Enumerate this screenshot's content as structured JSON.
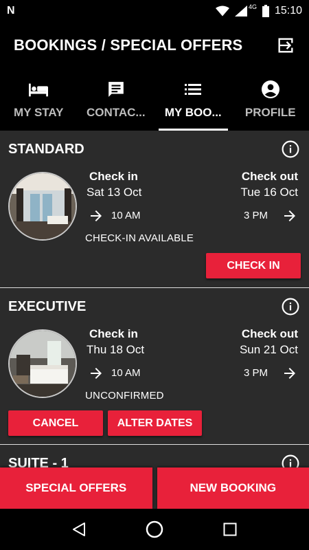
{
  "status_bar": {
    "time": "15:10",
    "network": "4G"
  },
  "app_bar": {
    "title": "BOOKINGS / SPECIAL OFFERS"
  },
  "tabs": [
    {
      "label": "MY STAY",
      "icon": "bed-icon"
    },
    {
      "label": "CONTAC...",
      "icon": "chat-icon"
    },
    {
      "label": "MY BOO...",
      "icon": "list-icon",
      "active": true
    },
    {
      "label": "PROFILE",
      "icon": "account-icon"
    }
  ],
  "bookings": [
    {
      "room": "STANDARD",
      "checkin_label": "Check in",
      "checkin_date": "Sat 13 Oct",
      "checkin_time": "10 AM",
      "checkout_label": "Check out",
      "checkout_date": "Tue 16 Oct",
      "checkout_time": "3 PM",
      "status": "CHECK-IN AVAILABLE",
      "actions": {
        "check_in": "CHECK IN"
      }
    },
    {
      "room": "EXECUTIVE",
      "checkin_label": "Check in",
      "checkin_date": "Thu 18 Oct",
      "checkin_time": "10 AM",
      "checkout_label": "Check out",
      "checkout_date": "Sun 21 Oct",
      "checkout_time": "3 PM",
      "status": "UNCONFIRMED",
      "actions": {
        "cancel": "CANCEL",
        "alter": "ALTER DATES"
      }
    },
    {
      "room": "SUITE - 1"
    }
  ],
  "bottom_actions": {
    "special_offers": "SPECIAL OFFERS",
    "new_booking": "NEW BOOKING"
  },
  "colors": {
    "accent": "#e8213a",
    "card_bg": "#2b2b2b",
    "bar_bg": "#000000"
  }
}
